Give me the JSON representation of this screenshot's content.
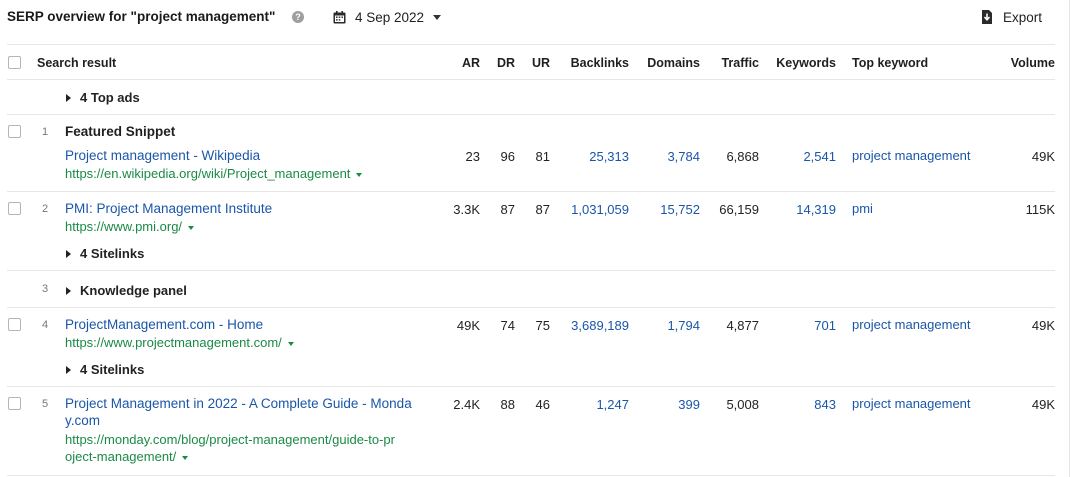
{
  "header": {
    "title": "SERP overview for \"project management\"",
    "help_glyph": "?",
    "date": "4 Sep 2022",
    "export_label": "Export"
  },
  "columns": {
    "search_result": "Search result",
    "ar": "AR",
    "dr": "DR",
    "ur": "UR",
    "backlinks": "Backlinks",
    "domains": "Domains",
    "traffic": "Traffic",
    "keywords": "Keywords",
    "top_keyword": "Top keyword",
    "volume": "Volume"
  },
  "top_ads": {
    "label": "4 Top ads"
  },
  "rows": [
    {
      "position": "1",
      "badge": "Featured Snippet",
      "title": "Project management - Wikipedia",
      "url": "https://en.wikipedia.org/wiki/Project_management",
      "ar": "23",
      "dr": "96",
      "ur": "81",
      "backlinks": "25,313",
      "domains": "3,784",
      "traffic": "6,868",
      "keywords": "2,541",
      "top_keyword": "project management",
      "volume": "49K"
    },
    {
      "position": "2",
      "title": "PMI: Project Management Institute",
      "url": "https://www.pmi.org/",
      "ar": "3.3K",
      "dr": "87",
      "ur": "87",
      "backlinks": "1,031,059",
      "domains": "15,752",
      "traffic": "66,159",
      "keywords": "14,319",
      "top_keyword": "pmi",
      "volume": "115K",
      "sitelinks": "4 Sitelinks"
    },
    {
      "position": "3",
      "knowledge_panel": "Knowledge panel"
    },
    {
      "position": "4",
      "title": "ProjectManagement.com - Home",
      "url": "https://www.projectmanagement.com/",
      "ar": "49K",
      "dr": "74",
      "ur": "75",
      "backlinks": "3,689,189",
      "domains": "1,794",
      "traffic": "4,877",
      "keywords": "701",
      "top_keyword": "project management",
      "volume": "49K",
      "sitelinks": "4 Sitelinks"
    },
    {
      "position": "5",
      "title_line1": "Project Management in 2022 - A Complete Guide - Monda",
      "title_line2": "y.com",
      "url_line1": "https://monday.com/blog/project-management/guide-to-pr",
      "url_line2": "oject-management/",
      "ar": "2.4K",
      "dr": "88",
      "ur": "46",
      "backlinks": "1,247",
      "domains": "399",
      "traffic": "5,008",
      "keywords": "843",
      "top_keyword": "project management",
      "volume": "49K"
    }
  ],
  "colors": {
    "link": "#1a56a8",
    "url": "#1a8a45",
    "rule": "#e6e6e6"
  }
}
